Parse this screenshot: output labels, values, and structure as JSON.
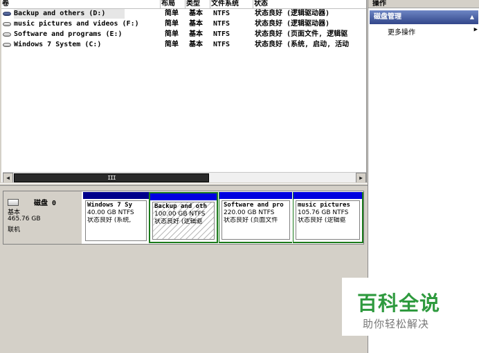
{
  "volume_list": {
    "columns": [
      "卷",
      "布局",
      "类型",
      "文件系统",
      "状态"
    ],
    "rows": [
      {
        "name": "Backup and others (D:)",
        "layout": "简单",
        "type": "基本",
        "fs": "NTFS",
        "status": "状态良好 (逻辑驱动器)",
        "icon": "volume-icon-selected"
      },
      {
        "name": "music pictures and videos (F:)",
        "layout": "简单",
        "type": "基本",
        "fs": "NTFS",
        "status": "状态良好 (逻辑驱动器)",
        "icon": "volume-icon"
      },
      {
        "name": "Software and programs (E:)",
        "layout": "简单",
        "type": "基本",
        "fs": "NTFS",
        "status": "状态良好 (页面文件, 逻辑驱",
        "icon": "volume-icon"
      },
      {
        "name": "Windows 7  System (C:)",
        "layout": "简单",
        "type": "基本",
        "fs": "NTFS",
        "status": "状态良好 (系统, 启动, 活动",
        "icon": "volume-icon"
      }
    ],
    "scroll_thumb_label": "III"
  },
  "disk": {
    "name": "磁盘 0",
    "type": "基本",
    "size": "465.76 GB",
    "status": "联机",
    "partitions": [
      {
        "name": "Windows 7  Sy",
        "size": "40.00 GB NTFS",
        "status": "状态良好 (系统,"
      },
      {
        "name": "Backup and oth",
        "size": "100.00 GB NTFS",
        "status": "状态良好 (逻辑驱"
      },
      {
        "name": "Software and pro",
        "size": "220.00 GB NTFS",
        "status": "状态良好 (页面文件"
      },
      {
        "name": "music pictures",
        "size": "105.76 GB NTFS",
        "status": "状态良好 (逻辑驱"
      }
    ]
  },
  "actions": {
    "header": "操作",
    "section": "磁盘管理",
    "more": "更多操作"
  },
  "watermark": {
    "title": "百科全说",
    "subtitle": "助你轻松解决"
  },
  "colors": {
    "partition_bar": "#00008b",
    "partition_bar_logical": "#0000e0",
    "selected_border": "#1a7a1a",
    "watermark_green": "#2e9a3e"
  }
}
